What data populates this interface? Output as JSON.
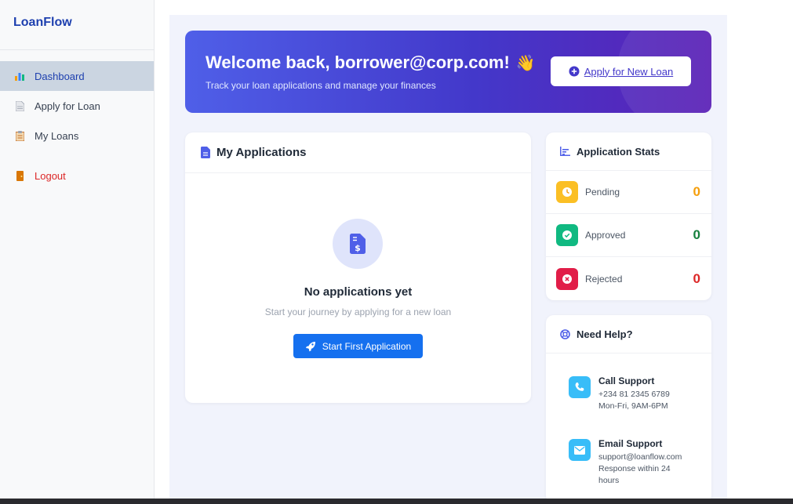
{
  "sidebar": {
    "brand": "LoanFlow",
    "items": [
      {
        "label": "Dashboard",
        "icon": "bar-chart-icon",
        "active": true
      },
      {
        "label": "Apply for Loan",
        "icon": "document-icon"
      },
      {
        "label": "My Loans",
        "icon": "clipboard-icon"
      },
      {
        "label": "Logout",
        "icon": "door-icon"
      }
    ]
  },
  "hero": {
    "title": "Welcome back, borrower@corp.com!",
    "emoji": "👋",
    "subtitle": "Track your loan applications and manage your finances",
    "button_label": "Apply for New Loan"
  },
  "applications": {
    "title": "My Applications",
    "empty_title": "No applications yet",
    "empty_subtitle": "Start your journey by applying for a new loan",
    "button_label": "Start First Application"
  },
  "stats": {
    "title": "Application Stats",
    "rows": [
      {
        "label": "Pending",
        "value": "0",
        "color": "#f59e0b"
      },
      {
        "label": "Approved",
        "value": "0",
        "color": "#15803d"
      },
      {
        "label": "Rejected",
        "value": "0",
        "color": "#dc2626"
      }
    ]
  },
  "help": {
    "title": "Need Help?",
    "call": {
      "title": "Call Support",
      "line1": "+234 81 2345 6789",
      "line2": "Mon-Fri, 9AM-6PM"
    },
    "email": {
      "title": "Email Support",
      "line1": "support@loanflow.com",
      "line2": "Response within 24",
      "line3": "hours"
    }
  },
  "colors": {
    "accent": "#4338ca",
    "primary_button": "#1570ef",
    "brand": "#1e40af"
  }
}
